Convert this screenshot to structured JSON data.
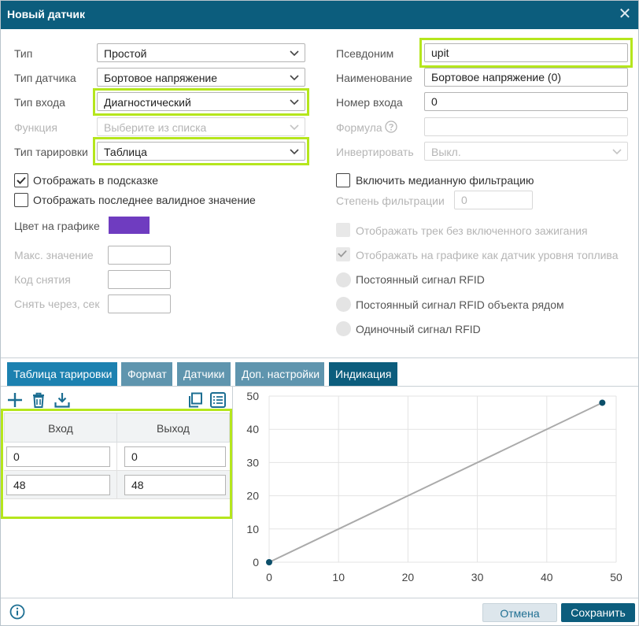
{
  "dialog": {
    "title": "Новый датчик",
    "close": "✕"
  },
  "left": {
    "type_label": "Тип",
    "type_value": "Простой",
    "sensor_type_label": "Тип датчика",
    "sensor_type_value": "Бортовое напряжение",
    "input_type_label": "Тип входа",
    "input_type_value": "Диагностический",
    "function_label": "Функция",
    "function_placeholder": "Выберите из списка",
    "calibration_type_label": "Тип тарировки",
    "calibration_type_value": "Таблица",
    "show_in_tooltip": "Отображать в подсказке",
    "show_last_valid": "Отображать последнее валидное значение",
    "graph_color_label": "Цвет на графике",
    "graph_color": "#6f3cc0",
    "max_value_label": "Макс. значение",
    "removal_code_label": "Код снятия",
    "remove_after_label": "Снять через, сек"
  },
  "right": {
    "alias_label": "Псевдоним",
    "alias_value": "upit",
    "name_label": "Наименование",
    "name_value": "Бортовое напряжение (0)",
    "input_number_label": "Номер входа",
    "input_number_value": "0",
    "formula_label": "Формула",
    "invert_label": "Инвертировать",
    "invert_value": "Выкл.",
    "median_filter": "Включить медианную фильтрацию",
    "filter_degree_label": "Степень фильтрации",
    "filter_degree_value": "0",
    "track_without_ignition": "Отображать трек без включенного зажигания",
    "show_as_fuel": "Отображать на графике как датчик уровня топлива",
    "rfid_constant": "Постоянный сигнал RFID",
    "rfid_constant_nearby": "Постоянный сигнал RFID объекта рядом",
    "rfid_single": "Одиночный сигнал RFID"
  },
  "tabs": [
    {
      "label": "Таблица тарировки"
    },
    {
      "label": "Формат"
    },
    {
      "label": "Датчики"
    },
    {
      "label": "Доп. настройки"
    },
    {
      "label": "Индикация"
    }
  ],
  "calibration_table": {
    "headers": [
      "Вход",
      "Выход"
    ],
    "rows": [
      [
        "0",
        "0"
      ],
      [
        "48",
        "48"
      ]
    ]
  },
  "chart_data": {
    "type": "line",
    "x": [
      0,
      48
    ],
    "y": [
      0,
      48
    ],
    "xlim": [
      0,
      50
    ],
    "ylim": [
      0,
      50
    ],
    "xticks": [
      "0",
      "10",
      "20",
      "30",
      "40",
      "50"
    ],
    "yticks": [
      "0",
      "10",
      "20",
      "30",
      "40",
      "50"
    ],
    "grid": true
  },
  "footer": {
    "cancel": "Отмена",
    "save": "Сохранить"
  },
  "colors": {
    "header": "#0c5d7d",
    "highlight": "#b5e61d",
    "tab_active": "#0c5d7d",
    "tab_primary": "#1c81b0"
  }
}
